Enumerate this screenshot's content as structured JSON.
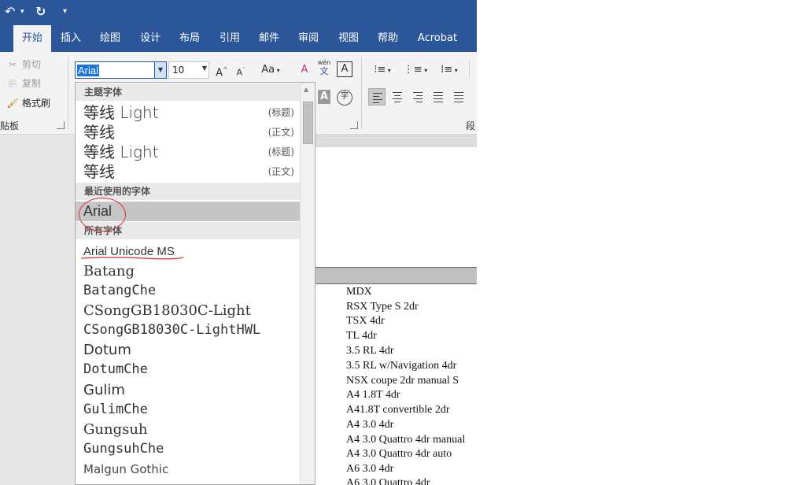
{
  "qat": {
    "undo_icon": "undo-icon",
    "redo_icon": "redo-icon",
    "customize_icon": "customize-icon"
  },
  "tabs": [
    {
      "label": "开始",
      "active": true
    },
    {
      "label": "插入"
    },
    {
      "label": "绘图"
    },
    {
      "label": "设计"
    },
    {
      "label": "布局"
    },
    {
      "label": "引用"
    },
    {
      "label": "邮件"
    },
    {
      "label": "审阅"
    },
    {
      "label": "视图"
    },
    {
      "label": "帮助"
    },
    {
      "label": "Acrobat"
    }
  ],
  "clipboard": {
    "cut": "剪切",
    "copy": "复制",
    "format_painter": "格式刷",
    "group_label": "贴板"
  },
  "font_group": {
    "font_name": "Arial",
    "font_size": "10",
    "change_case": "Aa",
    "phonetic_top": "wén",
    "phonetic_bottom": "文",
    "char_border": "A",
    "char_shading": "A",
    "enclose": "字"
  },
  "paragraph_group": {
    "label": "段"
  },
  "dropdown": {
    "sections": {
      "theme": "主题字体",
      "recent": "最近使用的字体",
      "all": "所有字体"
    },
    "theme_fonts": [
      {
        "name": "等线 Light",
        "tag": "(标题)"
      },
      {
        "name": "等线",
        "tag": "(正文)"
      },
      {
        "name": "等线 Light",
        "tag": "(标题)"
      },
      {
        "name": "等线",
        "tag": "(正文)"
      }
    ],
    "recent_fonts": [
      {
        "name": "Arial"
      }
    ],
    "all_fonts": [
      "Arial Unicode MS",
      "Batang",
      "BatangChe",
      "CSongGB18030C-Light",
      "CSongGB18030C-LightHWL",
      "Dotum",
      "DotumChe",
      "Gulim",
      "GulimChe",
      "Gungsuh",
      "GungsuhChe",
      "Malgun Gothic"
    ]
  },
  "document": {
    "rows": [
      "MDX",
      "RSX Type S 2dr",
      "TSX 4dr",
      "TL 4dr",
      "3.5 RL 4dr",
      "3.5 RL w/Navigation 4dr",
      "NSX coupe 2dr manual S",
      "A4 1.8T 4dr",
      "A41.8T convertible 2dr",
      "A4 3.0 4dr",
      "A4 3.0 Quattro 4dr manual",
      "A4 3.0 Quattro 4dr auto",
      "A6 3.0 4dr",
      "A6 3.0 Quattro 4dr"
    ]
  },
  "colors": {
    "accent": "#2b579a",
    "annotation": "#e03030",
    "highlight": "#1a73d8"
  }
}
